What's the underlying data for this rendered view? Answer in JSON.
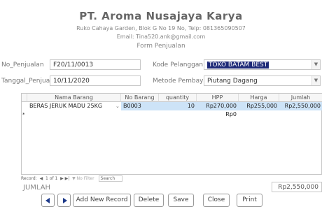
{
  "header": {
    "company": "PT. Aroma Nusajaya Karya",
    "address": "Ruko Cahaya Garden, Blok G No 19 No, Telp: 081365090507",
    "email": "Email: Tina520.ank@gmail.com",
    "form_title": "Form Penjualan"
  },
  "form": {
    "no_penjualan_label": "No_Penjualan",
    "no_penjualan_value": "F20/11/0013",
    "tanggal_label": "Tanggal_Penjual",
    "tanggal_value": "10/11/2020",
    "kode_pelanggan_label": "Kode Pelanggan",
    "kode_pelanggan_value": "TOKO BATAM BEST",
    "metode_label": "Metode Pembay",
    "metode_value": "Piutang Dagang"
  },
  "grid": {
    "columns": [
      "Nama Barang",
      "No Barang",
      "quantity",
      "HPP",
      "Harga",
      "Jumlah"
    ],
    "rows": [
      [
        "BERAS JERUK MADU 25KG",
        "B0003",
        "10",
        "Rp270,000",
        "Rp255,000",
        "Rp2,550,000"
      ]
    ],
    "new_row_marker": "*",
    "new_row_hpp": "Rp0"
  },
  "record_nav": {
    "label": "Record:",
    "position": "1 of 1",
    "filter": "No Filter",
    "search": "Search"
  },
  "totals": {
    "label": "JUMLAH",
    "value": "Rp2,550,000"
  },
  "buttons": {
    "add": "Add New Record",
    "delete": "Delete",
    "save": "Save",
    "close": "Close",
    "print": "Print"
  }
}
